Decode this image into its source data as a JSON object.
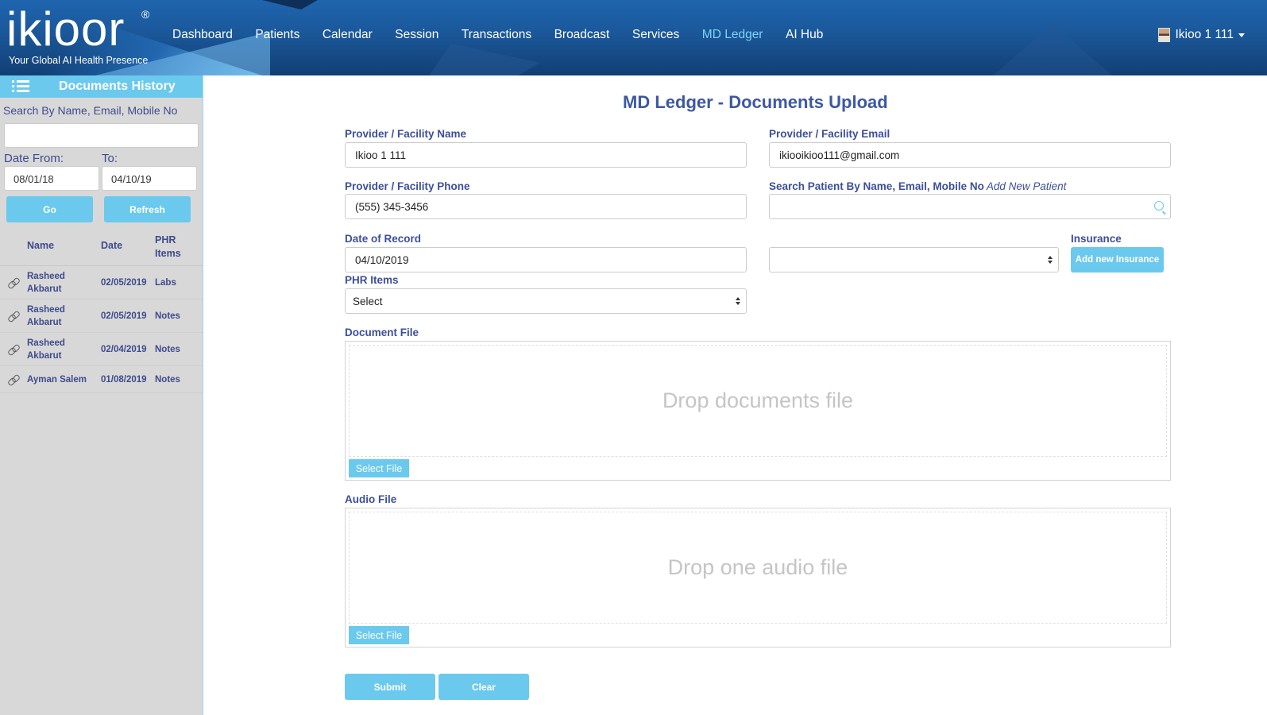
{
  "header": {
    "logo_text": "ikioor",
    "logo_reg": "®",
    "tagline": "Your Global AI Health Presence",
    "nav": [
      {
        "label": "Dashboard"
      },
      {
        "label": "Patients"
      },
      {
        "label": "Calendar"
      },
      {
        "label": "Session"
      },
      {
        "label": "Transactions"
      },
      {
        "label": "Broadcast"
      },
      {
        "label": "Services"
      },
      {
        "label": "MD Ledger",
        "active": true
      },
      {
        "label": "AI Hub"
      }
    ],
    "user_name": "Ikioo 1 111",
    "active_color": "#7fd4f6"
  },
  "sidebar": {
    "title": "Documents History",
    "search_label": "Search By Name, Email, Mobile No",
    "search_value": "",
    "date_from_label": "Date From:",
    "date_to_label": "To:",
    "date_from": "08/01/18",
    "date_to": "04/10/19",
    "go_label": "Go",
    "refresh_label": "Refresh",
    "columns": {
      "name": "Name",
      "date": "Date",
      "items": "PHR Items"
    },
    "rows": [
      {
        "name": "Rasheed Akbarut",
        "date": "02/05/2019",
        "items": "Labs"
      },
      {
        "name": "Rasheed Akbarut",
        "date": "02/05/2019",
        "items": "Notes"
      },
      {
        "name": "Rasheed Akbarut",
        "date": "02/04/2019",
        "items": "Notes"
      },
      {
        "name": "Ayman Salem",
        "date": "01/08/2019",
        "items": "Notes"
      }
    ]
  },
  "form": {
    "title": "MD Ledger - Documents Upload",
    "provider_name_label": "Provider / Facility Name",
    "provider_name": "Ikioo 1 111",
    "provider_email_label": "Provider / Facility Email",
    "provider_email": "ikiooikioo111@gmail.com",
    "provider_phone_label": "Provider / Facility Phone",
    "provider_phone": "(555) 345-3456",
    "patient_search_label": "Search Patient By Name, Email, Mobile No",
    "add_new_patient": "Add New Patient",
    "patient_search_value": "",
    "date_of_record_label": "Date of Record",
    "date_of_record": "04/10/2019",
    "insurance_label": "Insurance",
    "insurance_select_value": "",
    "add_insurance_label": "Add new Insurance",
    "phr_items_label": "PHR Items",
    "phr_items_value": "Select",
    "document_file_label": "Document File",
    "document_drop_text": "Drop documents file",
    "audio_file_label": "Audio File",
    "audio_drop_text": "Drop one audio file",
    "select_file_label": "Select File",
    "submit_label": "Submit",
    "clear_label": "Clear"
  },
  "colors": {
    "accent": "#6bc9ee",
    "label": "#3d4f9a",
    "title": "#3d58a3",
    "header_bg": "#1a5799"
  }
}
